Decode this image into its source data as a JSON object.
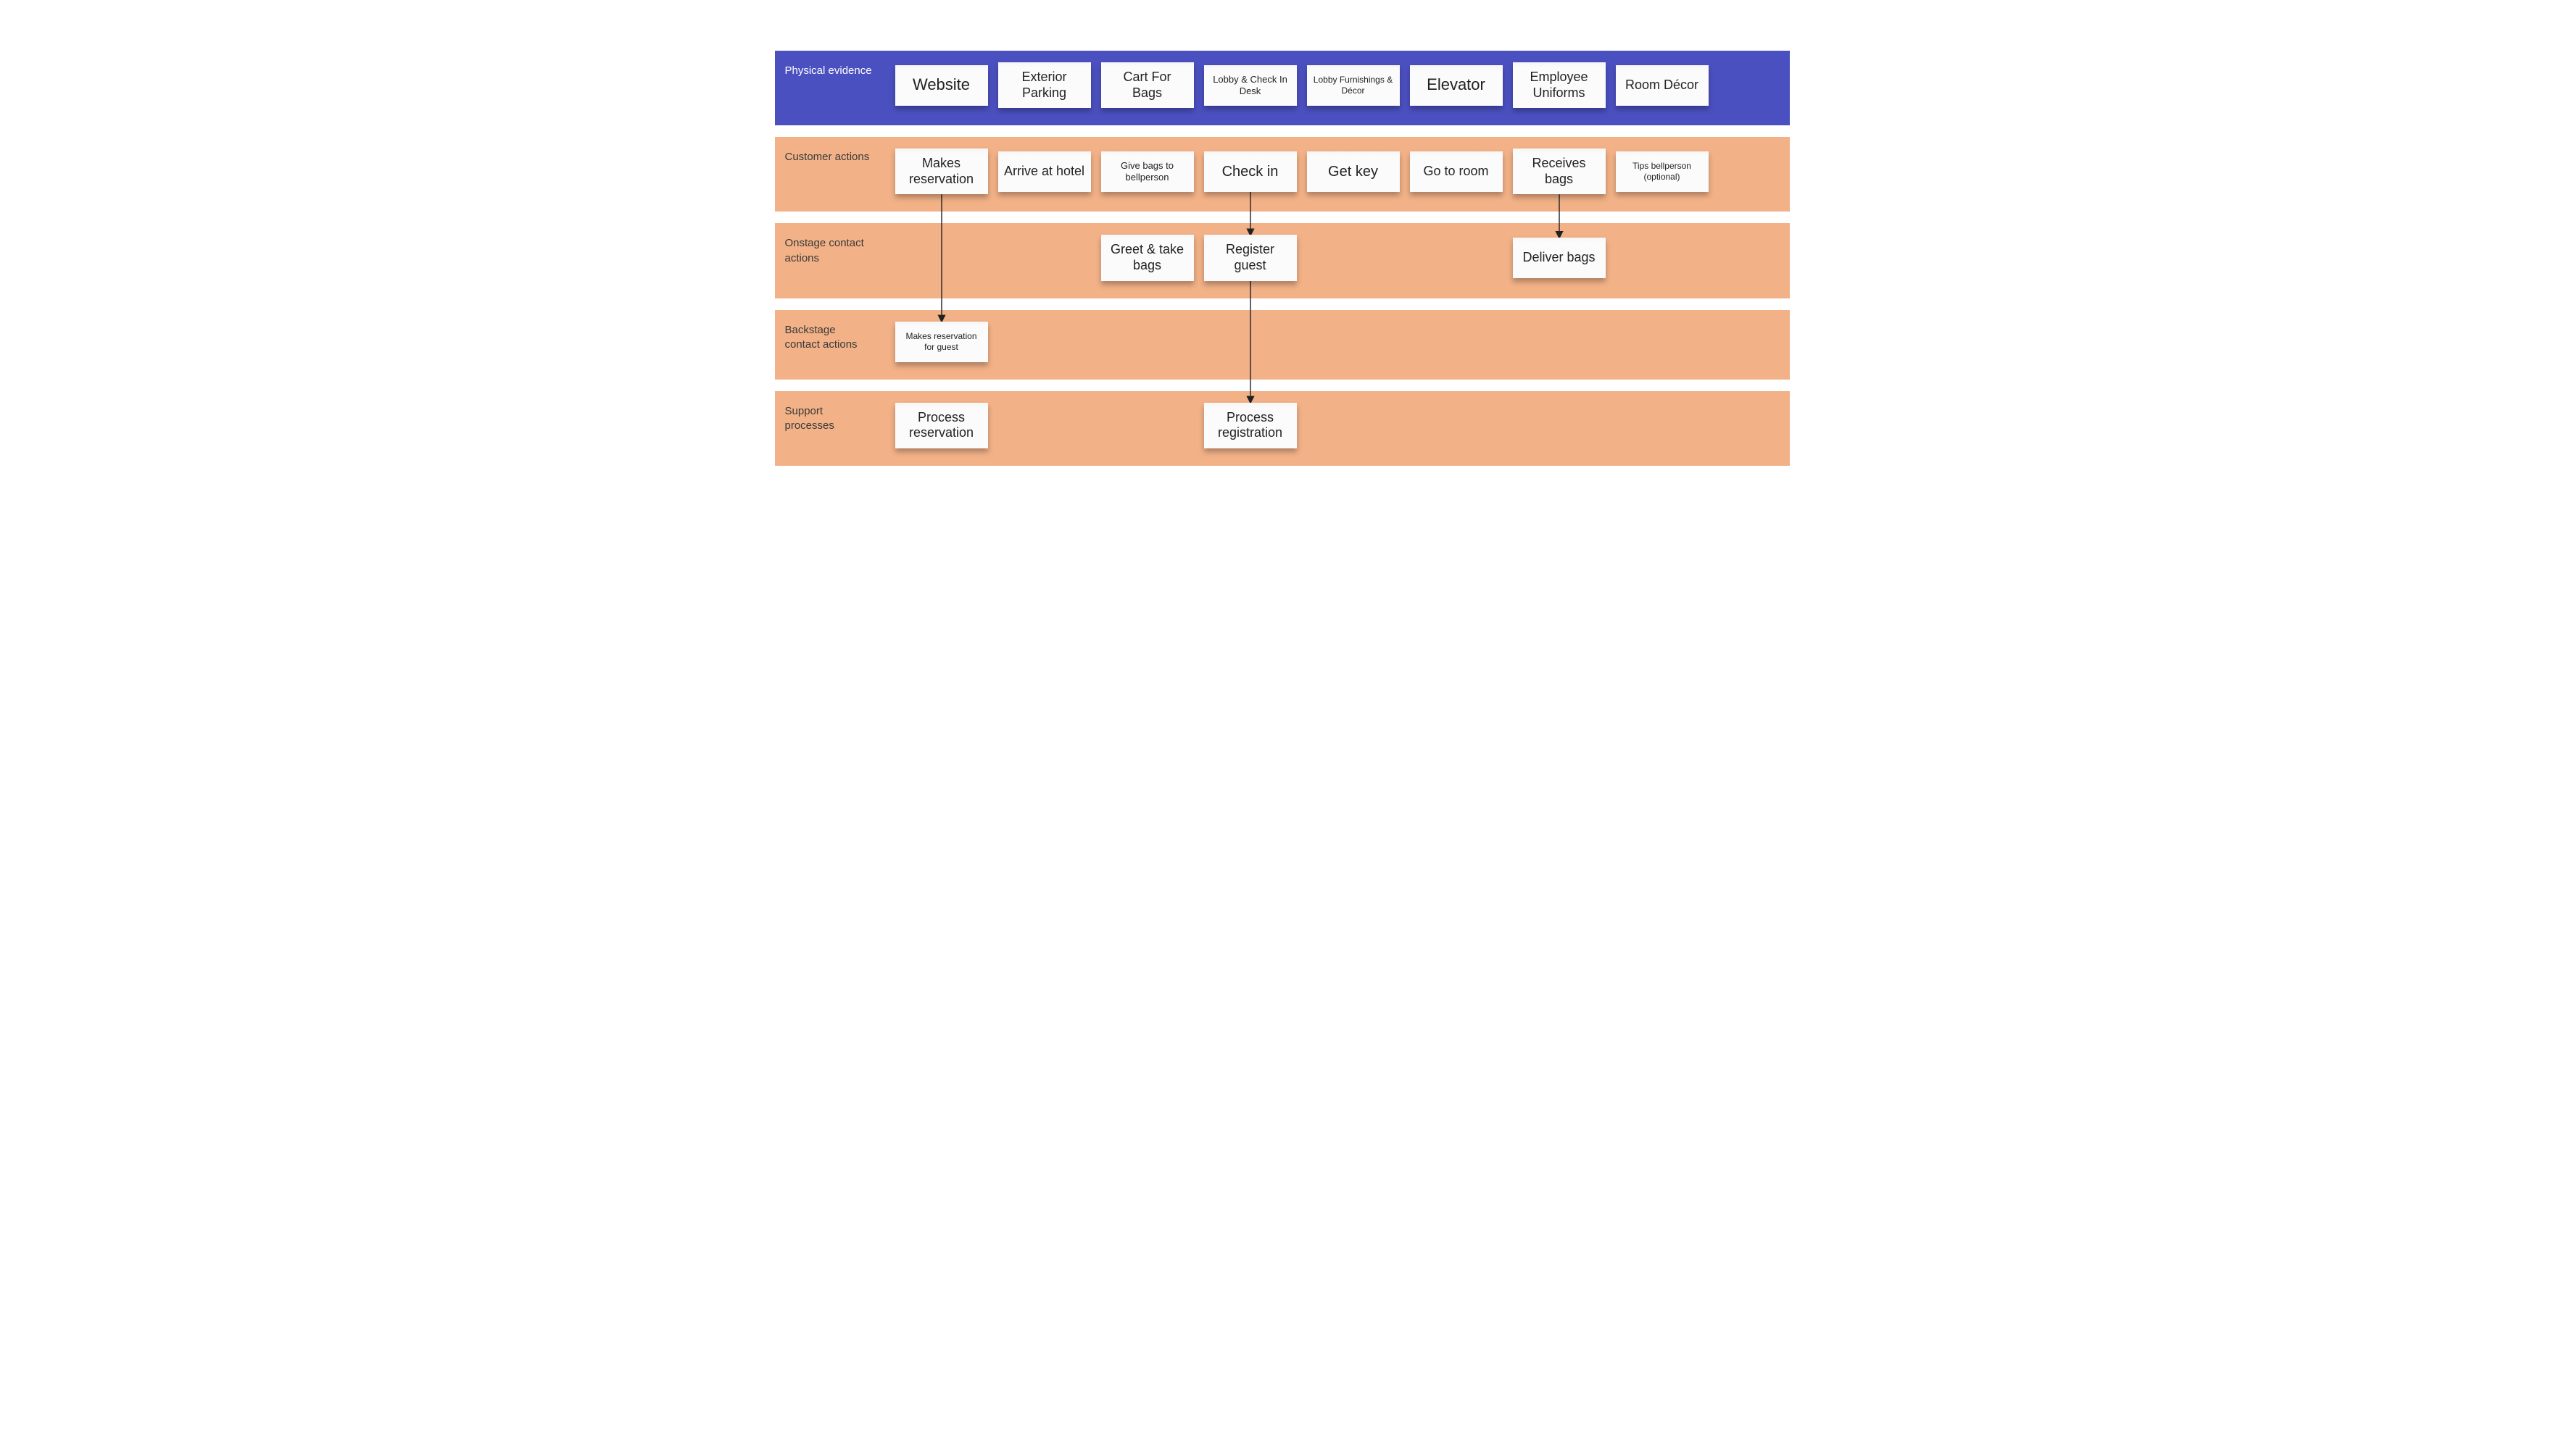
{
  "lanes": {
    "physical": {
      "label": "Physical evidence",
      "cards": [
        "Website",
        "Exterior Parking",
        "Cart For Bags",
        "Lobby & Check In Desk",
        "Lobby Furnishings & Décor",
        "Elevator",
        "Employee Uniforms",
        "Room Décor"
      ]
    },
    "customer": {
      "label": "Customer actions",
      "cards": [
        "Makes reservation",
        "Arrive at hotel",
        "Give bags to bellperson",
        "Check in",
        "Get key",
        "Go to room",
        "Receives bags",
        "Tips bellperson (optional)"
      ]
    },
    "onstage": {
      "label": "Onstage contact actions",
      "cards": [
        "Greet & take bags",
        "Register guest",
        "Deliver bags"
      ]
    },
    "backstage": {
      "label": "Backstage contact actions",
      "cards": [
        "Makes reservation for guest"
      ]
    },
    "support": {
      "label": "Support processes",
      "cards": [
        "Process reservation",
        "Process registration"
      ]
    }
  },
  "connectors": [
    {
      "from": "customer.0",
      "to": "backstage.0"
    },
    {
      "from": "customer.3",
      "to": "onstage.1"
    },
    {
      "from": "onstage.1",
      "to": "support.1"
    },
    {
      "from": "customer.6",
      "to": "onstage.2"
    }
  ]
}
